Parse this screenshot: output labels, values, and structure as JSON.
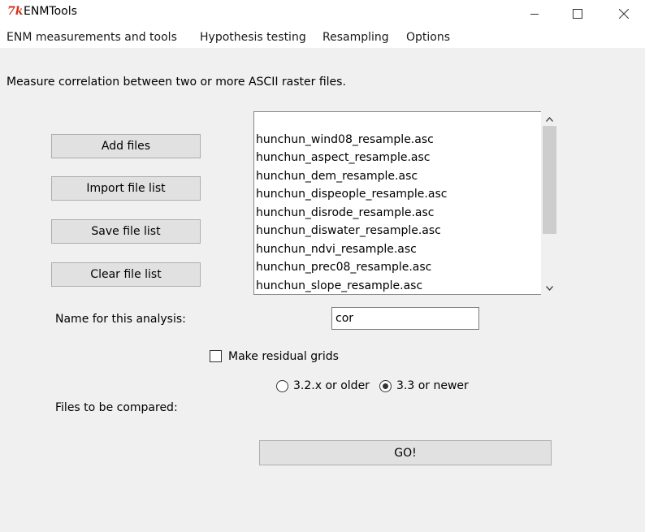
{
  "window": {
    "app_icon_glyph": "7k",
    "title": "ENMTools",
    "accent_color": "#d3321d"
  },
  "menu": [
    {
      "label": "ENM measurements and tools"
    },
    {
      "label": "Hypothesis testing"
    },
    {
      "label": "Resampling"
    },
    {
      "label": "Options"
    }
  ],
  "description": "Measure correlation between two or more ASCII raster files.",
  "buttons": {
    "add_files": "Add files",
    "import_file_list": "Import file list",
    "save_file_list": "Save file list",
    "clear_file_list": "Clear file list",
    "go": "GO!"
  },
  "file_list": {
    "items": [
      "hunchun_wind08_resample.asc",
      "hunchun_aspect_resample.asc",
      "hunchun_dem_resample.asc",
      "hunchun_dispeople_resample.asc",
      "hunchun_disrode_resample.asc",
      "hunchun_diswater_resample.asc",
      "hunchun_ndvi_resample.asc",
      "hunchun_prec08_resample.asc",
      "hunchun_slope_resample.asc"
    ]
  },
  "analysis_name": {
    "label": "Name for this analysis:",
    "value": "cor"
  },
  "residual_grids": {
    "label": "Make residual grids",
    "checked": false
  },
  "version_options": {
    "options": [
      "3.2.x or older",
      "3.3 or newer"
    ],
    "selected": "3.3 or newer"
  },
  "files_compared_label": "Files to be compared:"
}
